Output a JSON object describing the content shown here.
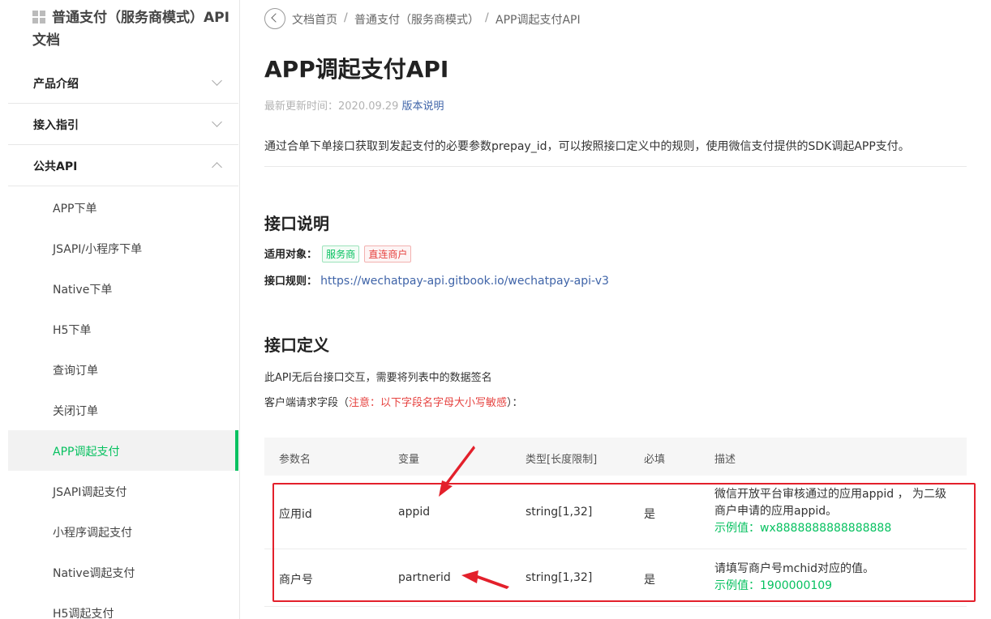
{
  "sidebar": {
    "doc_title": "普通支付（服务商模式）API文档",
    "sections": [
      {
        "label": "产品介绍",
        "expanded": false
      },
      {
        "label": "接入指引",
        "expanded": false
      },
      {
        "label": "公共API",
        "expanded": true
      }
    ],
    "items": [
      {
        "label": "APP下单",
        "active": false
      },
      {
        "label": "JSAPI/小程序下单",
        "active": false
      },
      {
        "label": "Native下单",
        "active": false
      },
      {
        "label": "H5下单",
        "active": false
      },
      {
        "label": "查询订单",
        "active": false
      },
      {
        "label": "关闭订单",
        "active": false
      },
      {
        "label": "APP调起支付",
        "active": true
      },
      {
        "label": "JSAPI调起支付",
        "active": false
      },
      {
        "label": "小程序调起支付",
        "active": false
      },
      {
        "label": "Native调起支付",
        "active": false
      },
      {
        "label": "H5调起支付",
        "active": false
      }
    ]
  },
  "breadcrumb": [
    "文档首页",
    "普通支付（服务商模式）",
    "APP调起支付API"
  ],
  "breadcrumb_sep": "/",
  "page": {
    "title": "APP调起支付API",
    "updated_label": "最新更新时间：2020.09.29",
    "version_link": "版本说明",
    "intro": "通过合单下单接口获取到发起支付的必要参数prepay_id，可以按照接口定义中的规则，使用微信支付提供的SDK调起APP支付。"
  },
  "interface_desc": {
    "heading": "接口说明",
    "applicable_label": "适用对象：",
    "tags": [
      "服务商",
      "直连商户"
    ],
    "rules_label": "接口规则：",
    "rules_link": "https://wechatpay-api.gitbook.io/wechatpay-api-v3"
  },
  "interface_def": {
    "heading": "接口定义",
    "note1": "此API无后台接口交互，需要将列表中的数据签名",
    "note2_prefix": "客户端请求字段（",
    "note2_warn": "注意：以下字段名字母大小写敏感",
    "note2_suffix": "）："
  },
  "table": {
    "headers": [
      "参数名",
      "变量",
      "类型[长度限制]",
      "必填",
      "描述"
    ],
    "rows": [
      {
        "name": "应用id",
        "var": "appid",
        "type": "string[1,32]",
        "required": "是",
        "desc": "微信开放平台审核通过的应用appid ， 为二级商户申请的应用appid。",
        "example": "示例值：wx8888888888888888"
      },
      {
        "name": "商户号",
        "var": "partnerid",
        "type": "string[1,32]",
        "required": "是",
        "desc": "请填写商户号mchid对应的值。",
        "example": "示例值：1900000109"
      }
    ]
  },
  "colors": {
    "accent": "#07c160",
    "link": "#3f64a8",
    "warning": "#e64340",
    "annotation": "#e3202b"
  }
}
